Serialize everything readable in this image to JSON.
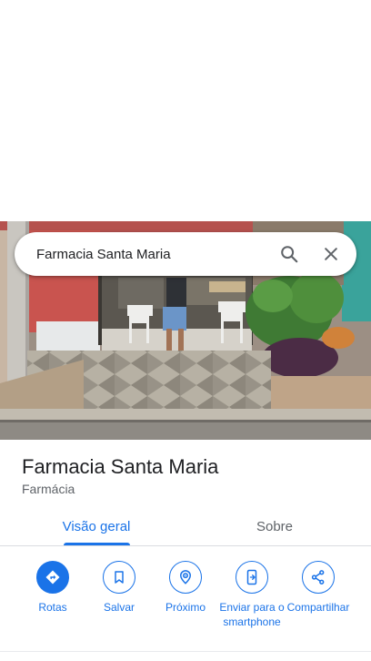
{
  "search": {
    "query": "Farmacia Santa Maria"
  },
  "place": {
    "name": "Farmacia Santa Maria",
    "category": "Farmácia"
  },
  "tabs": [
    {
      "label": "Visão geral",
      "selected": true
    },
    {
      "label": "Sobre",
      "selected": false
    }
  ],
  "actions": [
    {
      "label": "Rotas",
      "icon": "directions-icon",
      "filled": true
    },
    {
      "label": "Salvar",
      "icon": "bookmark-icon",
      "filled": false
    },
    {
      "label": "Próximo",
      "icon": "nearby-icon",
      "filled": false
    },
    {
      "label": "Enviar para o smartphone",
      "icon": "send-to-phone-icon",
      "filled": false
    },
    {
      "label": "Compartilhar",
      "icon": "share-icon",
      "filled": false
    }
  ],
  "colors": {
    "accent": "#1a73e8",
    "text_primary": "#202124",
    "text_secondary": "#5f6368",
    "divider": "#dadce0"
  }
}
